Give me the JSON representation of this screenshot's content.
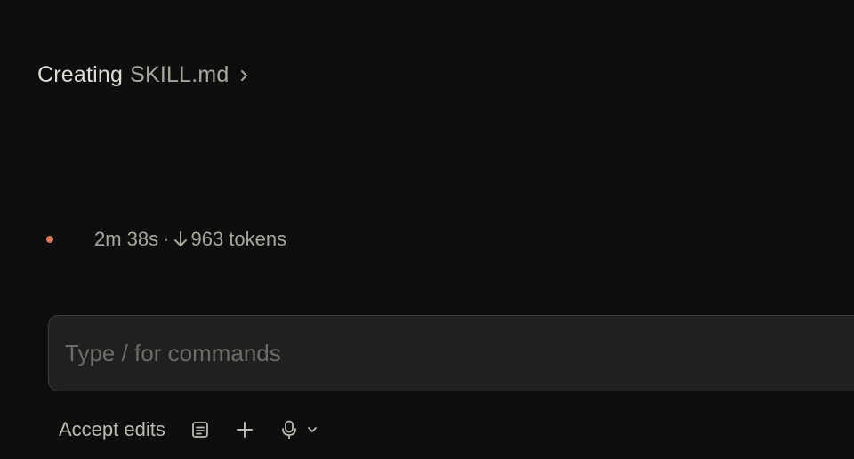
{
  "activity": {
    "verb": "Creating",
    "file": "SKILL.md",
    "icon": "chevron-right-icon"
  },
  "status": {
    "elapsed": "2m 38s",
    "separator": "·",
    "direction_icon": "arrow-down-icon",
    "tokens": "963 tokens",
    "dot_color": "#d9775a"
  },
  "input": {
    "placeholder": "Type / for commands",
    "value": ""
  },
  "toolbar": {
    "mode_label": "Accept edits",
    "icons": [
      "document-icon",
      "plus-icon",
      "microphone-icon",
      "chevron-down-icon"
    ]
  },
  "colors": {
    "background": "#0e0e0e",
    "input_background": "#202020",
    "input_border": "#3d3d3d",
    "accent": "#d9775a"
  }
}
